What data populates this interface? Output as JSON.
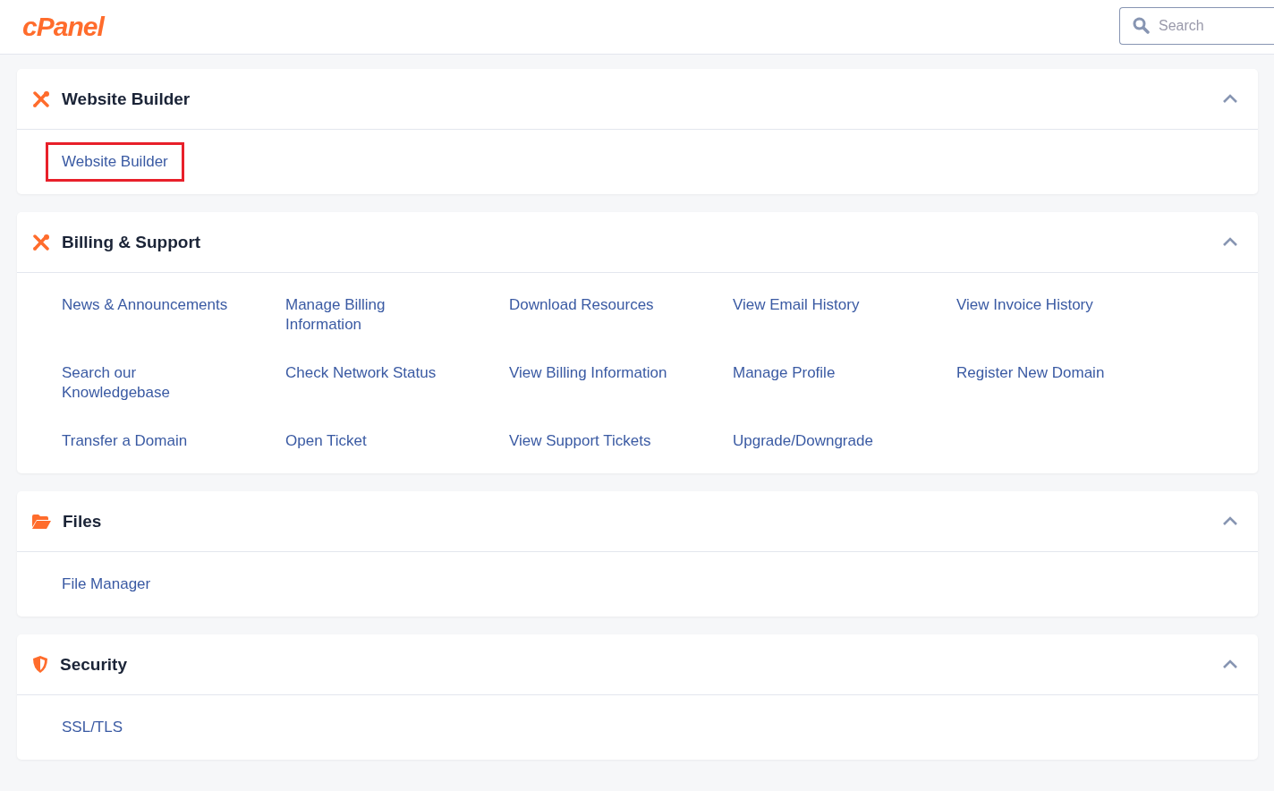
{
  "header": {
    "logo": "cPanel",
    "search": {
      "placeholder": "Search"
    }
  },
  "sections": [
    {
      "title": "Website Builder",
      "kind": "tools",
      "expanded": true,
      "links": [
        {
          "label": "Website Builder",
          "highlighted": true
        }
      ]
    },
    {
      "title": "Billing & Support",
      "kind": "tools",
      "expanded": true,
      "links": [
        {
          "label": "News & Announcements",
          "highlighted": false
        },
        {
          "label": "Manage Billing Information",
          "highlighted": false
        },
        {
          "label": "Download Resources",
          "highlighted": false
        },
        {
          "label": "View Email History",
          "highlighted": false
        },
        {
          "label": "View Invoice History",
          "highlighted": false
        },
        {
          "label": "Search our Knowledgebase",
          "highlighted": false
        },
        {
          "label": "Check Network Status",
          "highlighted": false
        },
        {
          "label": "View Billing Information",
          "highlighted": false
        },
        {
          "label": "Manage Profile",
          "highlighted": false
        },
        {
          "label": "Register New Domain",
          "highlighted": false
        },
        {
          "label": "Transfer a Domain",
          "highlighted": false
        },
        {
          "label": "Open Ticket",
          "highlighted": false
        },
        {
          "label": "View Support Tickets",
          "highlighted": false
        },
        {
          "label": "Upgrade/Downgrade",
          "highlighted": false
        }
      ]
    },
    {
      "title": "Files",
      "kind": "folder",
      "expanded": true,
      "links": [
        {
          "label": "File Manager",
          "highlighted": false
        }
      ]
    },
    {
      "title": "Security",
      "kind": "shield",
      "expanded": true,
      "links": [
        {
          "label": "SSL/TLS",
          "highlighted": false
        }
      ]
    }
  ]
}
